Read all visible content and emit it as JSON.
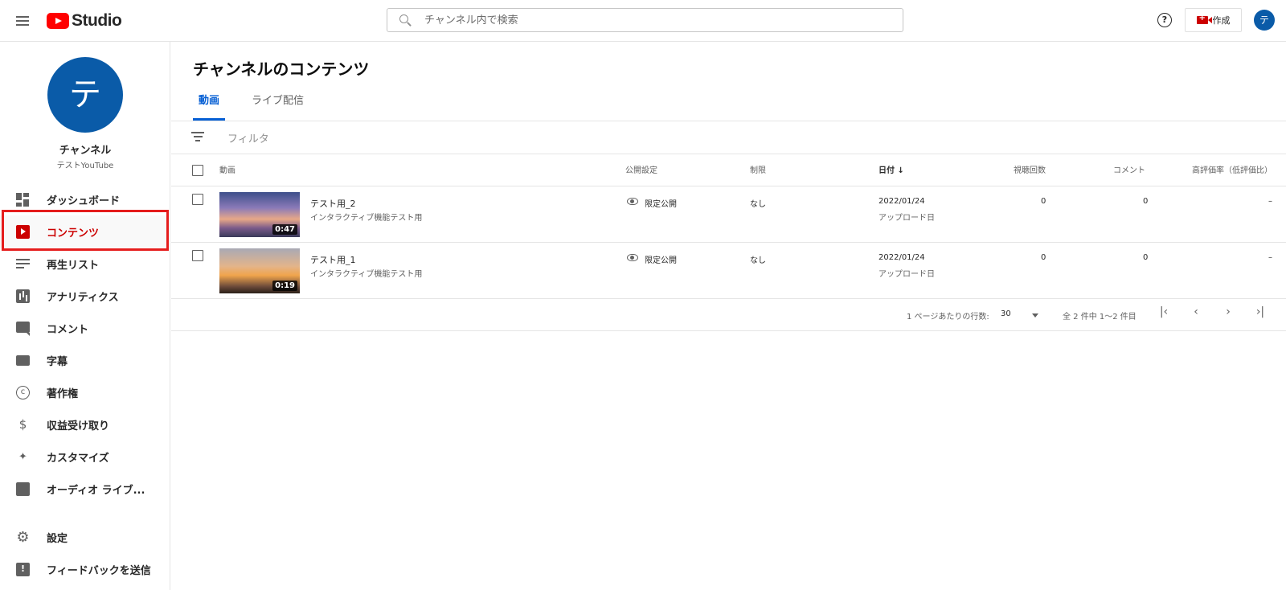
{
  "header": {
    "logo_text": "Studio",
    "search_placeholder": "チャンネル内で検索",
    "help_symbol": "?",
    "create_label": "作成",
    "avatar_letter": "テ"
  },
  "sidebar": {
    "avatar_letter": "テ",
    "channel_name": "チャンネル",
    "channel_handle": "テストYouTube",
    "items": [
      {
        "label": "ダッシュボード",
        "icon": "dashboard-icon"
      },
      {
        "label": "コンテンツ",
        "icon": "content-icon",
        "active": true
      },
      {
        "label": "再生リスト",
        "icon": "playlist-icon"
      },
      {
        "label": "アナリティクス",
        "icon": "analytics-icon"
      },
      {
        "label": "コメント",
        "icon": "comment-icon"
      },
      {
        "label": "字幕",
        "icon": "subtitles-icon"
      },
      {
        "label": "著作権",
        "icon": "copyright-icon"
      },
      {
        "label": "収益受け取り",
        "icon": "dollar-icon"
      },
      {
        "label": "カスタマイズ",
        "icon": "magic-wand-icon"
      },
      {
        "label": "オーディオ ライブ...",
        "icon": "audio-library-icon"
      }
    ],
    "footer_items": [
      {
        "label": "設定",
        "icon": "gear-icon"
      },
      {
        "label": "フィードバックを送信",
        "icon": "feedback-icon"
      }
    ]
  },
  "main": {
    "title": "チャンネルのコンテンツ",
    "tabs": [
      {
        "label": "動画",
        "active": true
      },
      {
        "label": "ライブ配信",
        "active": false
      }
    ],
    "filter_placeholder": "フィルタ",
    "columns": {
      "video": "動画",
      "visibility": "公開設定",
      "restrictions": "制限",
      "date": "日付",
      "views": "視聴回数",
      "comments": "コメント",
      "likes": "高評価率（低評価比）"
    },
    "rows": [
      {
        "title": "テスト用_2",
        "description": "インタラクティブ機能テスト用",
        "duration": "0:47",
        "visibility": "限定公開",
        "restrictions": "なし",
        "date": "2022/01/24",
        "date_label": "アップロード日",
        "views": "0",
        "comments": "0",
        "likes": "–"
      },
      {
        "title": "テスト用_1",
        "description": "インタラクティブ機能テスト用",
        "duration": "0:19",
        "visibility": "限定公開",
        "restrictions": "なし",
        "date": "2022/01/24",
        "date_label": "アップロード日",
        "views": "0",
        "comments": "0",
        "likes": "–"
      }
    ],
    "pagination": {
      "rows_per_page_label": "1 ページあたりの行数:",
      "rows_per_page": "30",
      "range": "全 2 件中 1〜2 件目",
      "first": "|‹",
      "prev": "‹",
      "next": "›",
      "last": "›|"
    }
  },
  "colors": {
    "brand_red": "#ff0000",
    "active_red": "#cc0000",
    "highlight_border": "#e51d1d",
    "tab_blue": "#065fd4",
    "avatar_blue": "#0a5ba8"
  }
}
